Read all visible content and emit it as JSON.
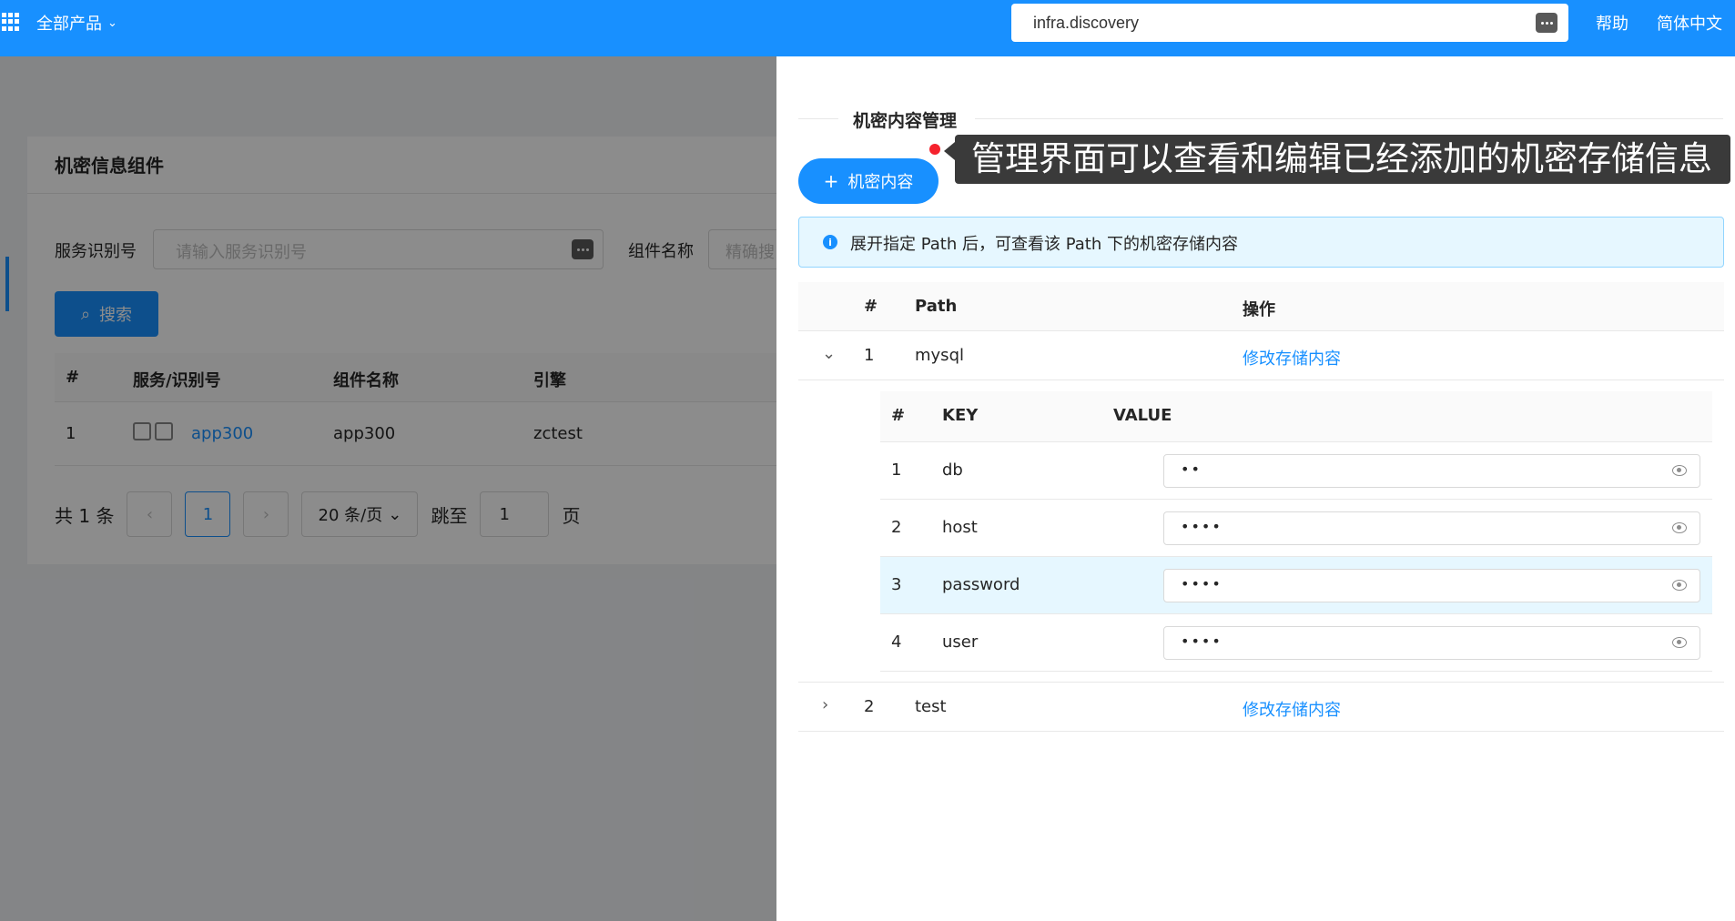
{
  "topbar": {
    "all_products": "全部产品",
    "search_value": "infra.discovery",
    "help": "帮助",
    "language": "简体中文"
  },
  "background": {
    "card_title": "机密信息组件",
    "filter": {
      "service_id_label": "服务识别号",
      "service_id_placeholder": "请输入服务识别号",
      "component_name_label": "组件名称",
      "component_name_placeholder": "精确搜"
    },
    "search_button": "搜索",
    "table": {
      "headers": [
        "#",
        "服务/识别号",
        "组件名称",
        "引擎"
      ],
      "rows": [
        {
          "index": "1",
          "service": "app300",
          "component": "app300",
          "engine": "zctest"
        }
      ]
    },
    "pagination": {
      "total": "共 1 条",
      "prev": "‹",
      "current_page": "1",
      "next": "›",
      "page_size": "20 条/页",
      "jump_label": "跳至",
      "jump_value": "1",
      "page_suffix": "页"
    }
  },
  "drawer": {
    "section_title": "机密内容管理",
    "add_button": "机密内容",
    "annotation": "管理界面可以查看和编辑已经添加的机密存储信息",
    "info_text": "展开指定 Path 后，可查看该 Path 下的机密存储内容",
    "table": {
      "headers": {
        "index": "#",
        "path": "Path",
        "action": "操作"
      },
      "rows": [
        {
          "index": "1",
          "path": "mysql",
          "action": "修改存储内容",
          "expanded": true
        },
        {
          "index": "2",
          "path": "test",
          "action": "修改存储内容",
          "expanded": false
        }
      ]
    },
    "sub_table": {
      "headers": {
        "index": "#",
        "key": "KEY",
        "value": "VALUE"
      },
      "rows": [
        {
          "index": "1",
          "key": "db",
          "masked": "••"
        },
        {
          "index": "2",
          "key": "host",
          "masked": "••••"
        },
        {
          "index": "3",
          "key": "password",
          "masked": "••••"
        },
        {
          "index": "4",
          "key": "user",
          "masked": "••••"
        }
      ]
    }
  },
  "colors": {
    "primary": "#1890ff",
    "annotation_bg": "#3a3a3a",
    "annotation_dot": "#f5222d"
  }
}
